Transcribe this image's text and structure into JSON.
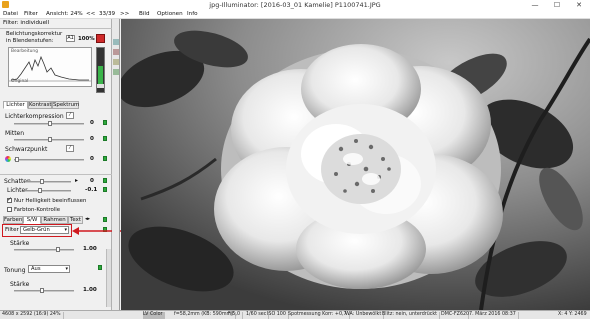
{
  "window": {
    "title": "jpg-Illuminator:  [2016-03_01 Kamelie]  P1100741.JPG",
    "controls": [
      "—",
      "☐",
      "✕"
    ]
  },
  "menu": {
    "items": [
      "Datei",
      "Filter",
      "Ansicht: 24%",
      "<<",
      "33/39",
      ">>",
      "Bild",
      "Optionen",
      "Info"
    ]
  },
  "panel": {
    "filter_title": "Filter: individuell",
    "exposure_label_1": "Belichtungskorrektur",
    "exposure_label_2": "in Blendenstufen:",
    "a1_badge": "A1",
    "zoom_percent": "100%",
    "hist_label_top": "Bearbeitung",
    "hist_label_bottom": "Original",
    "tabs_row1": [
      "Lichter",
      "Kontrast",
      "Spektrum"
    ],
    "lichterkompression": "Lichterkompression",
    "lichterkompression_value": "0",
    "mitten": "Mitten",
    "mitten_value": "0",
    "schwarzpunkt": "Schwarzpunkt",
    "schwarzpunkt_value": "0",
    "schatten": "Schatten",
    "schatten_value": "0",
    "lichter": "Lichter",
    "lichter_value": "-0.1",
    "cb_helligkeit": "Nur Helligkeit beeinflussen",
    "cb_helligkeit_checked": true,
    "cb_farbton": "Farbton-Kontrolle",
    "cb_farbton_checked": false,
    "tabs_row2": [
      "Farben",
      "S/W",
      "Rahmen",
      "Text"
    ],
    "filter_label": "Filter",
    "filter_value": "Gelb-Grün",
    "staerke_label": "Stärke",
    "staerke_value": "1.00",
    "tonung_label": "Tonung",
    "tonung_value": "Aus",
    "staerke2_label": "Stärke",
    "staerke2_value": "1.00",
    "highlight_color": "#d0191f",
    "accent_green": "#2eaa3c"
  },
  "statusbar": {
    "items": [
      "4608 x 2592 (16:9)  24%",
      "LV Color",
      "f=58,2mm (KB: 590mm)",
      "F/5,0",
      "1/60 sec",
      "ISO 100",
      "Spotmessung  Korr: +0,7",
      "WA: Unbewölkt",
      "Blitz: nein, unterdrückt",
      "DMC-FZ62",
      "07. März 2016  08:37",
      "X: 4  Y: 2469"
    ]
  }
}
